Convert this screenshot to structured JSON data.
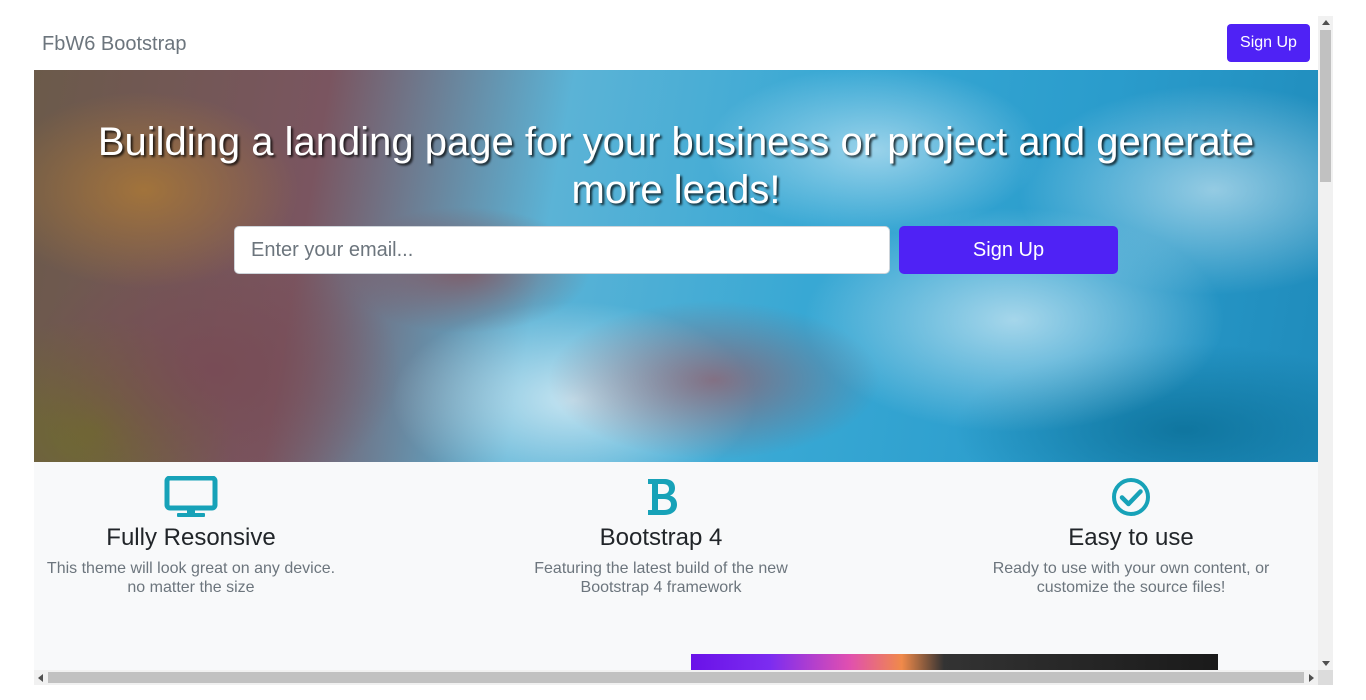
{
  "navbar": {
    "brand": "FbW6 Bootstrap",
    "signup_label": "Sign Up"
  },
  "hero": {
    "title": "Building a landing page for your business or project and generate more leads!",
    "email_placeholder": "Enter your email...",
    "signup_label": "Sign Up"
  },
  "features": [
    {
      "icon": "desktop-icon",
      "title": "Fully Resonsive",
      "text": "This theme will look great on any device. no matter the size"
    },
    {
      "icon": "bootstrap-icon",
      "title": "Bootstrap 4",
      "text": "Featuring the latest build of the new Bootstrap 4 framework"
    },
    {
      "icon": "check-circle-icon",
      "title": "Easy to use",
      "text": "Ready to use with your own content, or customize the source files!"
    }
  ],
  "colors": {
    "primary": "#4f22f5",
    "icon": "#17a2b8",
    "muted_text": "#6c757d",
    "section_bg": "#f8f9fa"
  }
}
